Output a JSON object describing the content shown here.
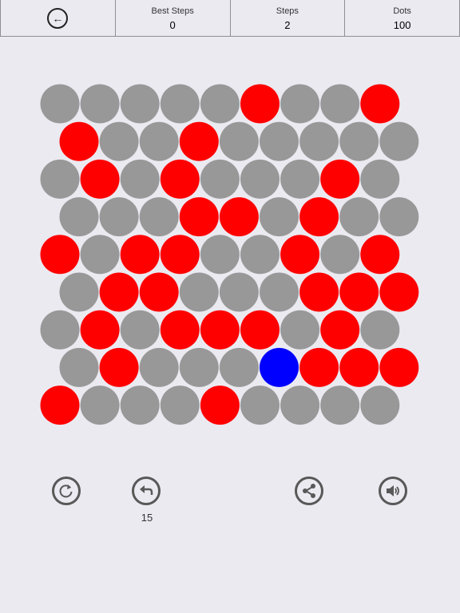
{
  "header": {
    "best_steps_label": "Best Steps",
    "best_steps_value": "0",
    "steps_label": "Steps",
    "steps_value": "2",
    "dots_label": "Dots",
    "dots_value": "100"
  },
  "board": {
    "colors": {
      "gray": "#989898",
      "red": "#ff0000",
      "blue": "#0000ff"
    },
    "rows": [
      [
        "gray",
        "gray",
        "gray",
        "gray",
        "gray",
        "red",
        "gray",
        "gray",
        "red"
      ],
      [
        "red",
        "gray",
        "gray",
        "red",
        "gray",
        "gray",
        "gray",
        "gray",
        "gray"
      ],
      [
        "gray",
        "red",
        "gray",
        "red",
        "gray",
        "gray",
        "gray",
        "red",
        "gray"
      ],
      [
        "gray",
        "gray",
        "gray",
        "red",
        "red",
        "gray",
        "red",
        "gray",
        "gray"
      ],
      [
        "red",
        "gray",
        "red",
        "red",
        "gray",
        "gray",
        "red",
        "gray",
        "red"
      ],
      [
        "gray",
        "red",
        "red",
        "gray",
        "gray",
        "gray",
        "red",
        "red",
        "red"
      ],
      [
        "gray",
        "red",
        "gray",
        "red",
        "red",
        "red",
        "gray",
        "red",
        "gray"
      ],
      [
        "gray",
        "red",
        "gray",
        "gray",
        "gray",
        "blue",
        "red",
        "red",
        "red"
      ],
      [
        "red",
        "gray",
        "gray",
        "gray",
        "red",
        "gray",
        "gray",
        "gray",
        "gray"
      ]
    ]
  },
  "controls": {
    "undo_count": "15",
    "icons": [
      "restart-icon",
      "undo-icon",
      "share-icon",
      "sound-icon"
    ]
  }
}
